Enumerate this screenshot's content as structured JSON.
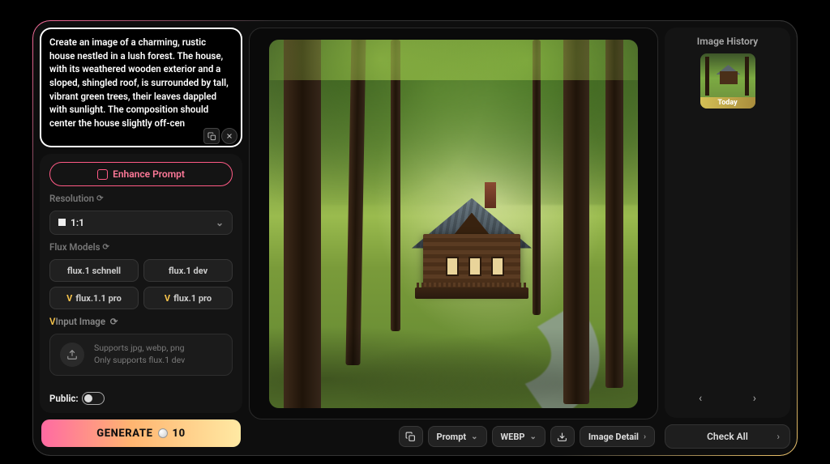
{
  "prompt": {
    "text": "Create an image of a charming, rustic house nestled in a lush forest. The house, with its weathered wooden exterior and a sloped, shingled roof, is surrounded by tall, vibrant green trees, their leaves dappled with sunlight. The composition should center the house slightly off-cen"
  },
  "enhance": {
    "label": "Enhance Prompt"
  },
  "resolution": {
    "label": "Resolution",
    "value": "1:1"
  },
  "models": {
    "label": "Flux Models",
    "items": [
      "flux.1 schnell",
      "flux.1 dev",
      "flux.1.1 pro",
      "flux.1 pro"
    ]
  },
  "input_image": {
    "label": "Input Image",
    "hint1": "Supports jpg, webp, png",
    "hint2": "Only supports flux.1 dev"
  },
  "public": {
    "label": "Public:"
  },
  "generate": {
    "label": "GENERATE",
    "cost": "10"
  },
  "toolbar": {
    "prompt": "Prompt",
    "format": "WEBP",
    "detail": "Image Detail"
  },
  "history": {
    "title": "Image History",
    "thumb_label": "Today",
    "check_all": "Check All"
  }
}
